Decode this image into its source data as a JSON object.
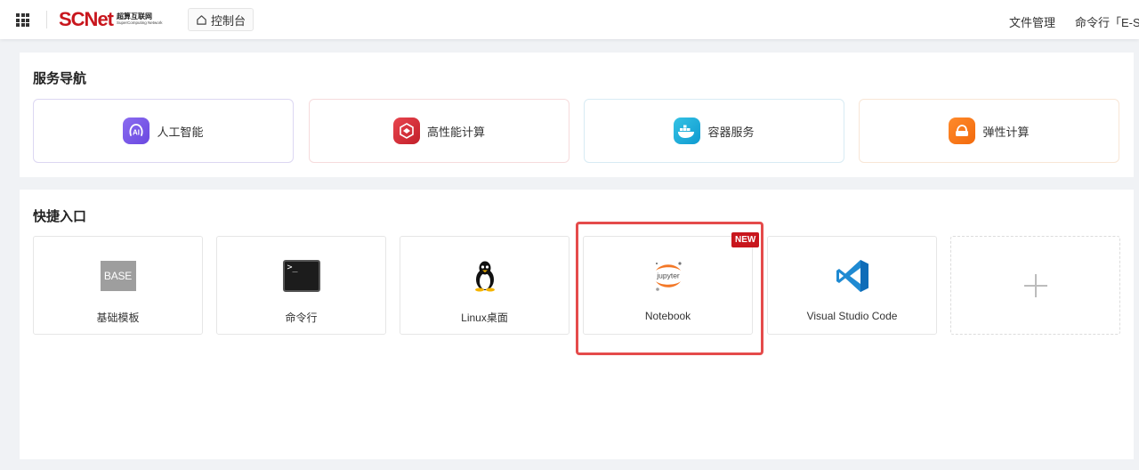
{
  "header": {
    "logo_main": "SCNet",
    "logo_cn": "超算互联网",
    "logo_en": "SuperComputing Network",
    "console_label": "控制台",
    "file_mgmt": "文件管理",
    "cmd_line": "命令行「E-S"
  },
  "service_nav": {
    "title": "服务导航",
    "items": [
      {
        "label": "人工智能",
        "icon": "ai-icon"
      },
      {
        "label": "高性能计算",
        "icon": "hpc-icon"
      },
      {
        "label": "容器服务",
        "icon": "docker-icon"
      },
      {
        "label": "弹性计算",
        "icon": "cloud-server-icon"
      }
    ]
  },
  "quick_access": {
    "title": "快捷入口",
    "items": [
      {
        "label": "基础模板",
        "icon": "base-icon",
        "icon_text": "BASE"
      },
      {
        "label": "命令行",
        "icon": "terminal-icon",
        "icon_text": ">_"
      },
      {
        "label": "Linux桌面",
        "icon": "linux-tux-icon"
      },
      {
        "label": "Notebook",
        "icon": "jupyter-icon",
        "icon_text": "jupyter",
        "badge": "NEW"
      },
      {
        "label": "Visual Studio Code",
        "icon": "vscode-icon"
      }
    ],
    "add_icon": "plus-icon"
  },
  "colors": {
    "brand": "#c8161d",
    "highlight": "#e54b4b",
    "ai": "#7b5ce8",
    "hpc": "#d6303a",
    "container": "#1aa8dc",
    "elastic": "#f57a1b",
    "vscode": "#1f8ad2"
  }
}
